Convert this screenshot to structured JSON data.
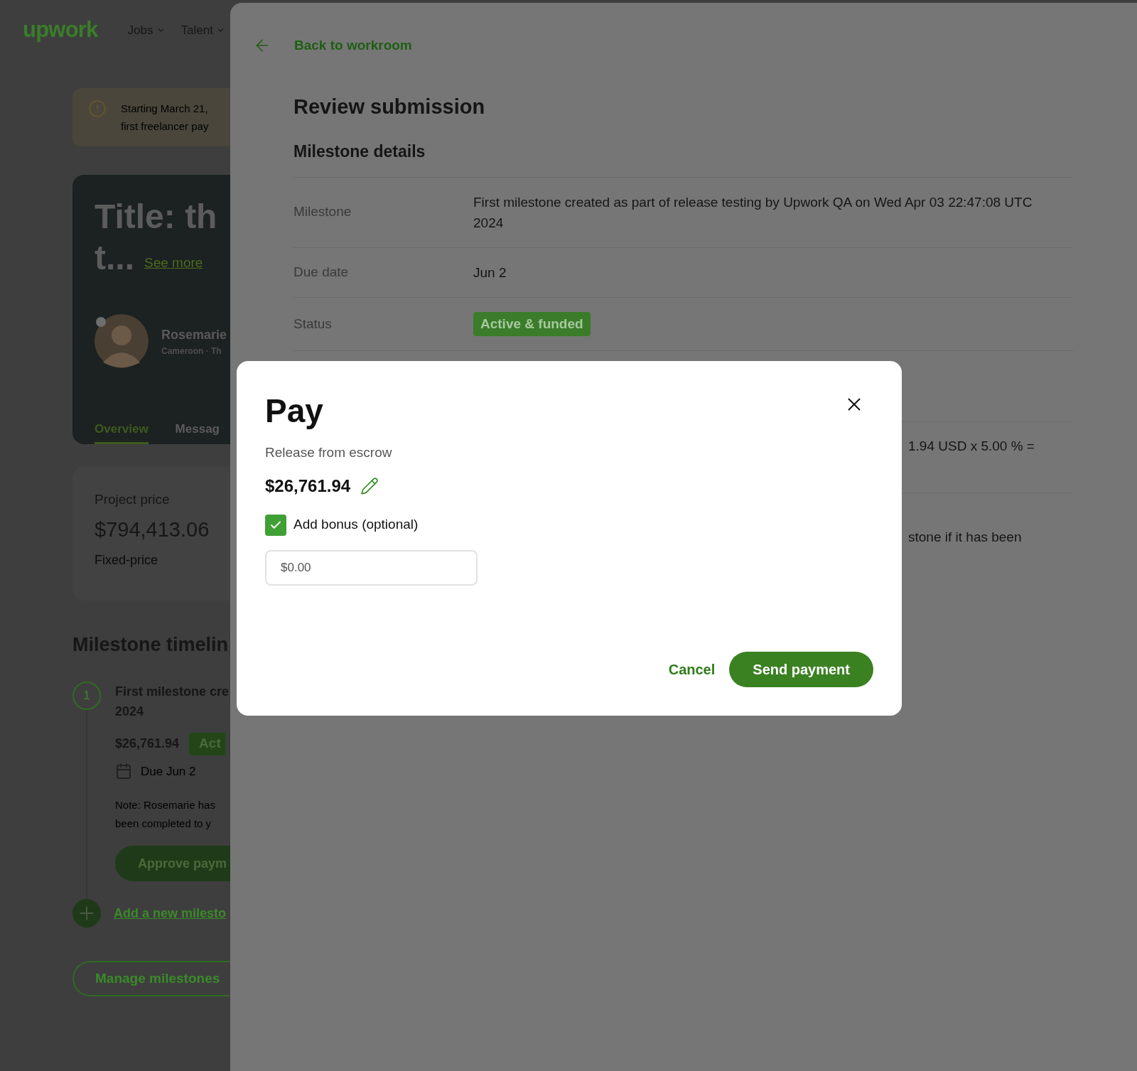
{
  "header": {
    "logo": "upwork",
    "nav": [
      {
        "label": "Jobs"
      },
      {
        "label": "Talent"
      }
    ]
  },
  "banner": {
    "lines": [
      "Starting March 21,",
      "first freelancer pay"
    ]
  },
  "contract_card": {
    "title": "Title: th",
    "title_line_2": "t...",
    "see_more": "See more",
    "freelancer": {
      "name": "Rosemarie",
      "meta": "Cameroon · Th",
      "online": true
    },
    "tabs": [
      {
        "label": "Overview",
        "selected": true
      },
      {
        "label": "Messag",
        "selected": false
      }
    ]
  },
  "price_card": {
    "label": "Project price",
    "amount": "$794,413.06",
    "type": "Fixed-price"
  },
  "timeline": {
    "heading": "Milestone timelin",
    "milestones": [
      {
        "number": "1",
        "title": "First milestone cre",
        "title_line_2": "2024",
        "amount": "$26,761.94",
        "status": "Act",
        "due": "Due Jun 2",
        "note": [
          "Note: Rosemarie has",
          "been completed to y"
        ],
        "action": "Approve paym"
      }
    ],
    "add_link": "Add a new milesto",
    "manage_button": "Manage milestones"
  },
  "drawer": {
    "back": "Back to workroom",
    "title": "Review submission",
    "section": "Milestone details",
    "rows": [
      {
        "kind": "text",
        "label": "Milestone",
        "value": "First milestone created as part of release testing by Upwork QA on Wed Apr 03 22:47:08 UTC 2024"
      },
      {
        "kind": "text",
        "label": "Due date",
        "value": "Jun 2"
      },
      {
        "kind": "badge",
        "label": "Status",
        "value": "Active & funded"
      }
    ],
    "covered_rows": [
      {
        "value": ""
      },
      {
        "value": "1.94 USD x 5.00 % ="
      },
      {
        "value": "stone if it has been"
      }
    ]
  },
  "modal": {
    "title": "Pay",
    "subtitle": "Release from escrow",
    "amount": "$26,761.94",
    "bonus": {
      "label": "Add bonus (optional)",
      "checked": true,
      "placeholder": "$0.00"
    },
    "cancel": "Cancel",
    "submit": "Send payment"
  }
}
